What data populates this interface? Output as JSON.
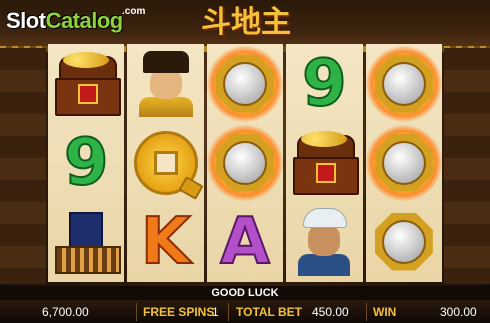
{
  "brand": {
    "name_a": "Slot",
    "name_b": "Catalog",
    "suffix": ".com"
  },
  "game": {
    "logo_text": "斗地主"
  },
  "reels": [
    [
      "treasure-chest",
      "green-9",
      "abacus-book"
    ],
    [
      "emperor",
      "gold-coin-q",
      "orange-k"
    ],
    [
      "bagua-mirror-fire",
      "bagua-mirror-fire",
      "purple-a"
    ],
    [
      "green-9",
      "treasure-chest",
      "turban-man"
    ],
    [
      "bagua-mirror-fire",
      "bagua-mirror-fire",
      "bagua-mirror"
    ]
  ],
  "symbols": {
    "nine": "9",
    "k": "K",
    "a": "A"
  },
  "message": "GOOD LUCK",
  "status": {
    "balance": "6,700.00",
    "free_spins_label": "FREE SPINS",
    "free_spins_value": "1",
    "total_bet_label": "TOTAL BET",
    "total_bet_value": "450.00",
    "win_label": "WIN",
    "win_value": "300.00"
  },
  "colors": {
    "gold": "#f2c23a",
    "green_brand": "#8ed13a",
    "reel_bg": "#f4e6c4"
  }
}
